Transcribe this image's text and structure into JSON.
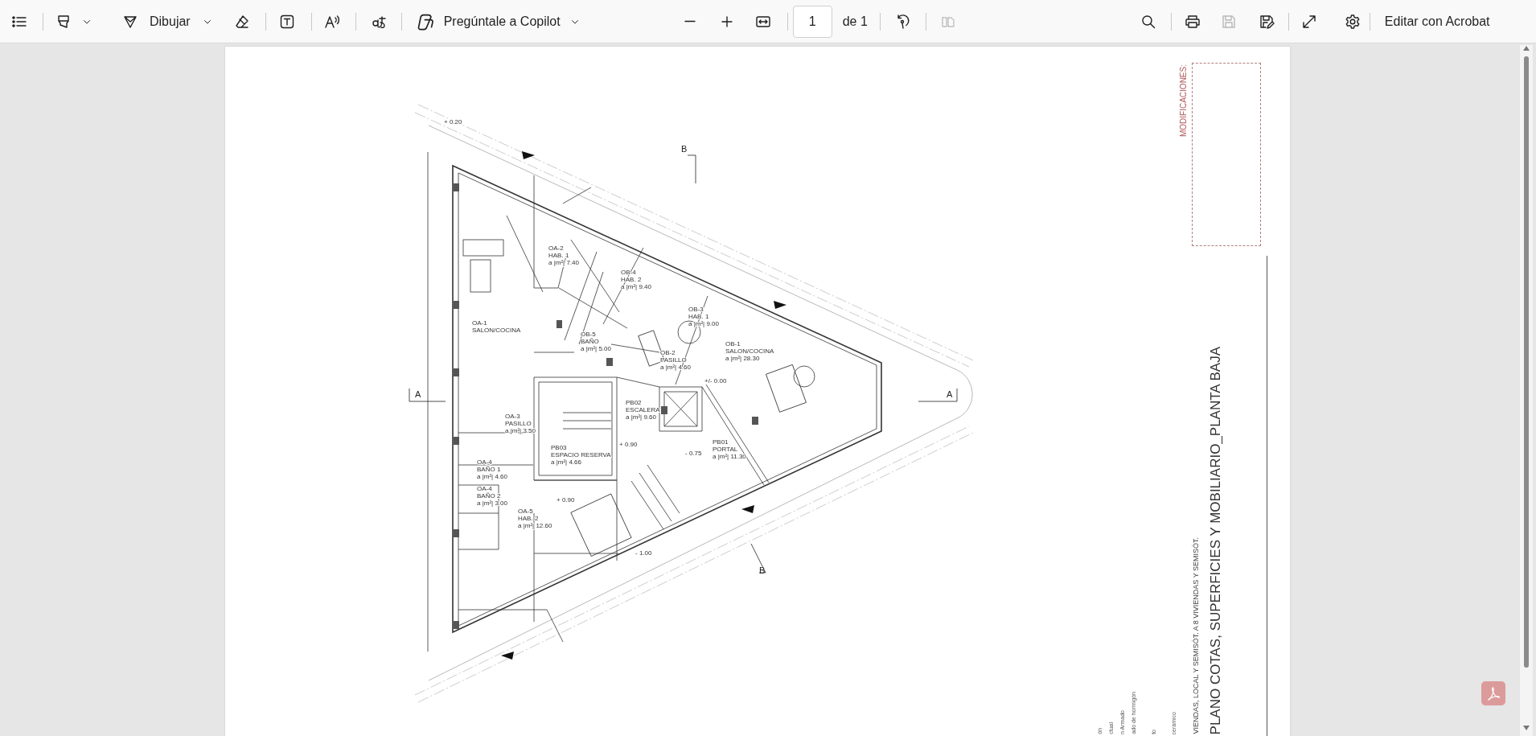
{
  "toolbar": {
    "draw_label": "Dibujar",
    "copilot_label": "Pregúntale a Copilot",
    "page_field": {
      "value": "1"
    },
    "page_count": "de 1",
    "two_page_view": {
      "disabled": true
    },
    "save": {
      "disabled": true
    },
    "edit_label": "Editar con Acrobat"
  },
  "document": {
    "plan": {
      "section_marks": [
        {
          "label": "B",
          "kind": "top"
        },
        {
          "label": "A",
          "kind": "left"
        },
        {
          "label": "A",
          "kind": "right"
        },
        {
          "label": "B",
          "kind": "bottom"
        }
      ],
      "rooms": [
        {
          "code": "OA-2",
          "name": "HAB. 1",
          "area": "a |m²| 7.40"
        },
        {
          "code": "OB-4",
          "name": "HAB. 2",
          "area": "a |m²| 9.40"
        },
        {
          "code": "OB-3",
          "name": "HAB. 1",
          "area": "a |m²| 9.00"
        },
        {
          "code": "OA-1",
          "name": "SALON/COCINA"
        },
        {
          "code": "OB-5",
          "name": "BAÑO",
          "area": "a |m²| 5.00"
        },
        {
          "code": "OB-2",
          "name": "PASILLO",
          "area": "a |m²| 4.60"
        },
        {
          "code": "OB-1",
          "name": "SALON/COCINA",
          "area": "a |m²| 28.30"
        },
        {
          "code": "PB02",
          "name": "ESCALERA",
          "area": "a |m²| 9.60"
        },
        {
          "code": "OA-3",
          "name": "PASILLO",
          "area": "a |m²| 3.50"
        },
        {
          "code": "PB01",
          "name": "PORTAL",
          "area": "a |m²| 11.30"
        },
        {
          "code": "PB03",
          "name": "ESPACIO RESERVA",
          "area": "a |m²| 4.66"
        },
        {
          "code": "OA-4",
          "name": "BAÑO 1",
          "area": "a |m²| 4.60"
        },
        {
          "code": "OA-4",
          "name": "BAÑO 2",
          "area": "a |m²| 3.00"
        },
        {
          "code": "OA-5",
          "name": "HAB. 2",
          "area": "a |m²| 12.60"
        }
      ],
      "levels": [
        "+ 0.20",
        "+/- 0.00",
        "+ 0.90",
        "- 0.75",
        "+ 0.90",
        "- 1.00"
      ]
    },
    "title_block": {
      "modifications_label": "MODIFICACIONES:",
      "title": "PLANO COTAS, SUPERFICIES Y MOBILIARIO_PLANTA BAJA",
      "subtitle": "VIENDAS, LOCAL Y SEMISÓT. A 8 VIVIENDAS Y SEMISÓT.",
      "notes": [
        "ón",
        "ctual",
        "n Armado",
        "ado de hormigón",
        "to",
        "cerámico"
      ]
    }
  }
}
